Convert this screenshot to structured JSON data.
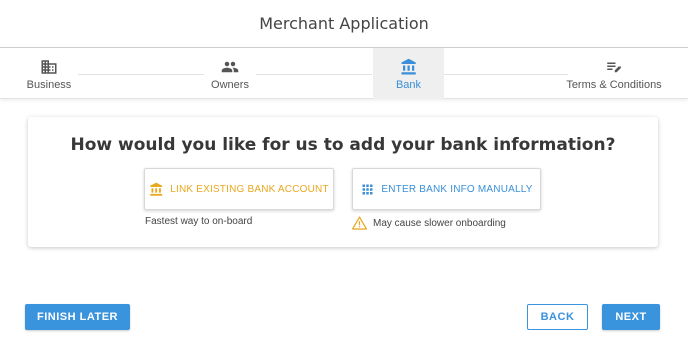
{
  "app": {
    "title": "Merchant Application"
  },
  "stepper": {
    "steps": [
      {
        "label": "Business",
        "icon": "building-icon",
        "active": false
      },
      {
        "label": "Owners",
        "icon": "people-icon",
        "active": false
      },
      {
        "label": "Bank",
        "icon": "bank-icon",
        "active": true
      },
      {
        "label": "Terms & Conditions",
        "icon": "edit-list-icon",
        "active": false
      }
    ]
  },
  "card": {
    "question": "How would you like for us to add your bank information?",
    "options": [
      {
        "label": "LINK EXISTING BANK ACCOUNT",
        "icon": "bank-icon",
        "hint": "Fastest way to on-board"
      },
      {
        "label": "ENTER BANK INFO MANUALLY",
        "icon": "keypad-icon",
        "hint": "May cause slower onboarding",
        "hint_icon": "warning-icon"
      }
    ]
  },
  "footer": {
    "finish_later": "FINISH LATER",
    "back": "BACK",
    "next": "NEXT"
  },
  "colors": {
    "accent": "#3a93dd",
    "link_option": "#e8a820",
    "warning": "#e8a820",
    "active_step_bg": "#efefef"
  }
}
